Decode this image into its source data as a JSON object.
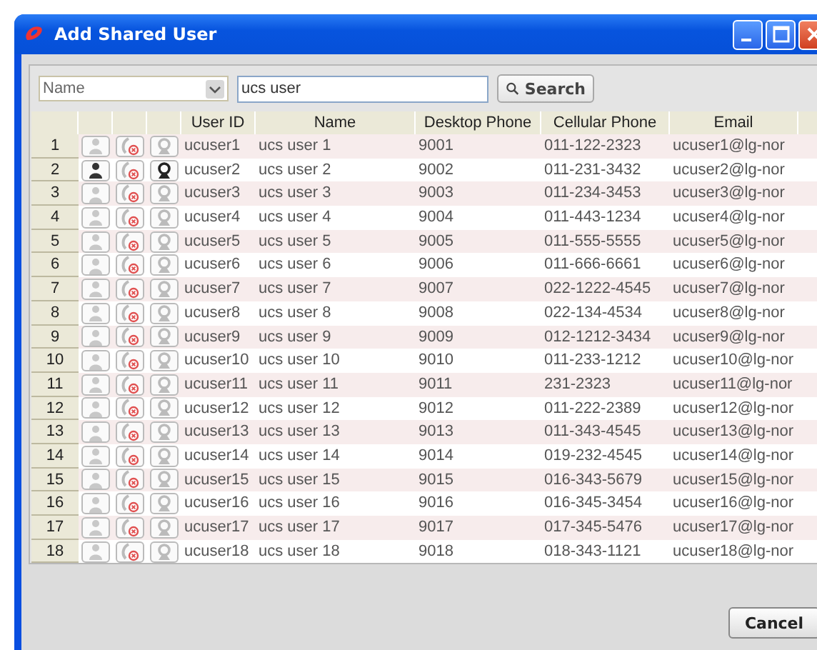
{
  "window": {
    "title": "Add Shared User"
  },
  "filter": {
    "field": "Name",
    "query": "ucs user",
    "button": "Search"
  },
  "table": {
    "columns": [
      "User ID",
      "Name",
      "Desktop Phone",
      "Cellular Phone",
      "Email"
    ],
    "rows": [
      {
        "number": "1",
        "online": false,
        "user_id": "ucuser1",
        "name": "ucs user 1",
        "desktop": "9001",
        "cellular": "011-122-2323",
        "email": "ucuser1@lg-nor"
      },
      {
        "number": "2",
        "online": true,
        "user_id": "ucuser2",
        "name": "ucs user 2",
        "desktop": "9002",
        "cellular": "011-231-3432",
        "email": "ucuser2@lg-nor"
      },
      {
        "number": "3",
        "online": false,
        "user_id": "ucuser3",
        "name": "ucs user 3",
        "desktop": "9003",
        "cellular": "011-234-3453",
        "email": "ucuser3@lg-nor"
      },
      {
        "number": "4",
        "online": false,
        "user_id": "ucuser4",
        "name": "ucs user  4",
        "desktop": "9004",
        "cellular": "011-443-1234",
        "email": "ucuser4@lg-nor"
      },
      {
        "number": "5",
        "online": false,
        "user_id": "ucuser5",
        "name": "ucs user 5",
        "desktop": "9005",
        "cellular": "011-555-5555",
        "email": "ucuser5@lg-nor"
      },
      {
        "number": "6",
        "online": false,
        "user_id": "ucuser6",
        "name": "ucs user 6",
        "desktop": "9006",
        "cellular": "011-666-6661",
        "email": "ucuser6@lg-nor"
      },
      {
        "number": "7",
        "online": false,
        "user_id": "ucuser7",
        "name": "ucs user 7",
        "desktop": "9007",
        "cellular": "022-1222-4545",
        "email": "ucuser7@lg-nor"
      },
      {
        "number": "8",
        "online": false,
        "user_id": "ucuser8",
        "name": "ucs user 8",
        "desktop": "9008",
        "cellular": "022-134-4534",
        "email": "ucuser8@lg-nor"
      },
      {
        "number": "9",
        "online": false,
        "user_id": "ucuser9",
        "name": "ucs user 9",
        "desktop": "9009",
        "cellular": "012-1212-3434",
        "email": "ucuser9@lg-nor"
      },
      {
        "number": "10",
        "online": false,
        "user_id": "ucuser10",
        "name": "ucs user 10",
        "desktop": "9010",
        "cellular": "011-233-1212",
        "email": "ucuser10@lg-nor"
      },
      {
        "number": "11",
        "online": false,
        "user_id": "ucuser11",
        "name": "ucs user 11",
        "desktop": "9011",
        "cellular": "231-2323",
        "email": "ucuser11@lg-nor"
      },
      {
        "number": "12",
        "online": false,
        "user_id": "ucuser12",
        "name": "ucs user 12",
        "desktop": "9012",
        "cellular": "011-222-2389",
        "email": "ucuser12@lg-nor"
      },
      {
        "number": "13",
        "online": false,
        "user_id": "ucuser13",
        "name": "ucs user 13",
        "desktop": "9013",
        "cellular": "011-343-4545",
        "email": "ucuser13@lg-nor"
      },
      {
        "number": "14",
        "online": false,
        "user_id": "ucuser14",
        "name": "ucs user 14",
        "desktop": "9014",
        "cellular": "019-232-4545",
        "email": "ucuser14@lg-nor"
      },
      {
        "number": "15",
        "online": false,
        "user_id": "ucuser15",
        "name": "ucs user 15",
        "desktop": "9015",
        "cellular": "016-343-5679",
        "email": "ucuser15@lg-nor"
      },
      {
        "number": "16",
        "online": false,
        "user_id": "ucuser16",
        "name": "ucs user 16",
        "desktop": "9016",
        "cellular": "016-345-3454",
        "email": "ucuser16@lg-nor"
      },
      {
        "number": "17",
        "online": false,
        "user_id": "ucuser17",
        "name": "ucs user 17",
        "desktop": "9017",
        "cellular": "017-345-5476",
        "email": "ucuser17@lg-nor"
      },
      {
        "number": "18",
        "online": false,
        "user_id": "ucuser18",
        "name": "ucs user 18",
        "desktop": "9018",
        "cellular": "018-343-1121",
        "email": "ucuser18@lg-nor"
      }
    ]
  },
  "buttons": [
    "Cancel"
  ]
}
